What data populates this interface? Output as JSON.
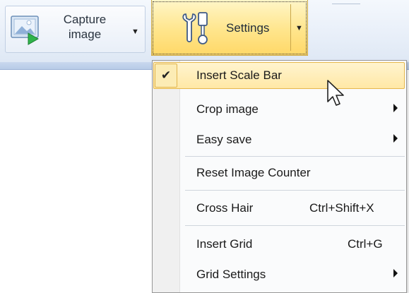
{
  "toolbar": {
    "capture_label": "Capture\nimage",
    "settings_label": "Settings"
  },
  "menu": {
    "items": [
      {
        "label": "Insert Scale Bar",
        "checked": true,
        "highlighted": true
      },
      {
        "label": "Crop image",
        "submenu": true
      },
      {
        "label": "Easy save",
        "submenu": true
      },
      {
        "label": "Reset Image Counter"
      },
      {
        "label": "Cross Hair",
        "shortcut": "Ctrl+Shift+X"
      },
      {
        "label": "Insert Grid",
        "shortcut": "Ctrl+G"
      },
      {
        "label": "Grid Settings",
        "submenu": true
      }
    ]
  },
  "colors": {
    "highlight": "#ffe8a6",
    "settings_button": "#ffe58c",
    "ribbon": "#e7eef8"
  },
  "icons": {
    "capture": "picture-with-play-icon",
    "settings": "wrench-and-tools-icon",
    "check": "check-icon",
    "cursor": "mouse-pointer-icon"
  }
}
